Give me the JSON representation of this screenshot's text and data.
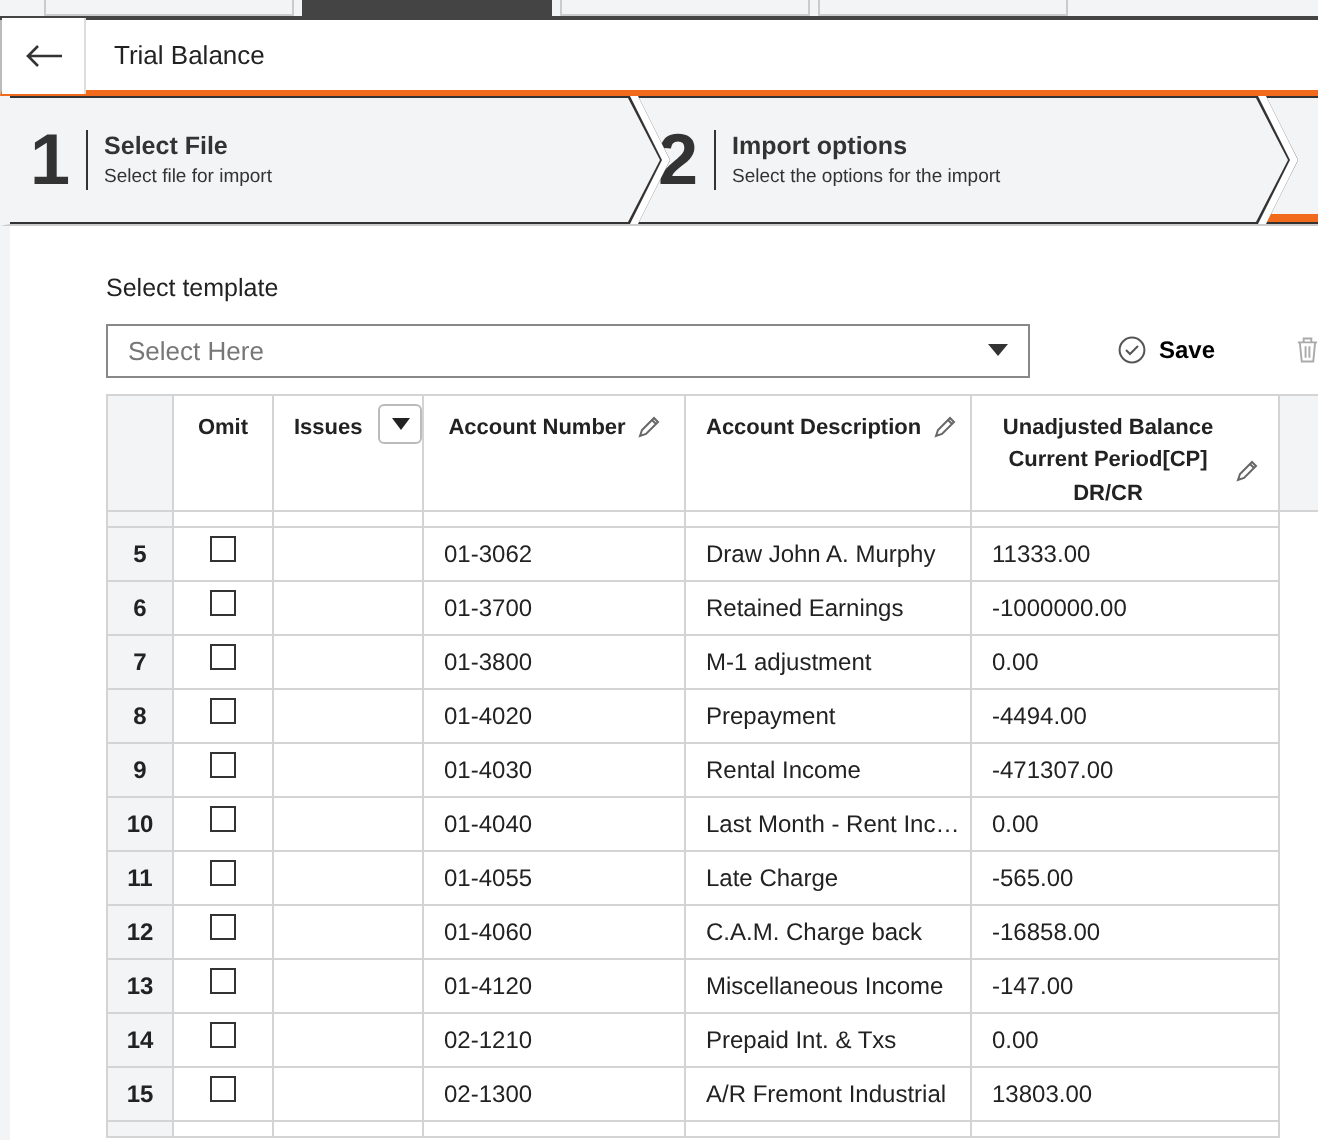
{
  "app_tabs": [
    {
      "selected": false
    },
    {
      "selected": true
    },
    {
      "selected": false
    },
    {
      "selected": false
    }
  ],
  "header": {
    "title": "Trial Balance"
  },
  "steps": [
    {
      "number": "1",
      "title": "Select File",
      "subtitle": "Select file for import",
      "selected": false
    },
    {
      "number": "2",
      "title": "Import options",
      "subtitle": "Select the options for the import",
      "selected": false
    },
    {
      "selected": true
    }
  ],
  "template": {
    "label": "Select template",
    "placeholder": "Select Here",
    "save": "Save"
  },
  "table": {
    "columns": [
      {
        "label": "Omit",
        "editable": false,
        "filter": false
      },
      {
        "label": "Issues",
        "editable": false,
        "filter": true
      },
      {
        "label": "Account Number",
        "editable": true,
        "filter": false
      },
      {
        "label": "Account Description",
        "editable": true,
        "filter": false
      },
      {
        "label": "Unadjusted Balance Current Period[CP] DR/CR",
        "editable": true,
        "filter": false
      }
    ],
    "rows": [
      {
        "index": "5",
        "checked": false,
        "account_number": "01-3062",
        "account_description": "Draw John A. Murphy",
        "balance": "11333.00"
      },
      {
        "index": "6",
        "checked": false,
        "account_number": "01-3700",
        "account_description": "Retained Earnings",
        "balance": "-1000000.00"
      },
      {
        "index": "7",
        "checked": false,
        "account_number": "01-3800",
        "account_description": "M-1 adjustment",
        "balance": "0.00"
      },
      {
        "index": "8",
        "checked": false,
        "account_number": "01-4020",
        "account_description": "Prepayment",
        "balance": "-4494.00"
      },
      {
        "index": "9",
        "checked": false,
        "account_number": "01-4030",
        "account_description": "Rental Income",
        "balance": "-471307.00"
      },
      {
        "index": "10",
        "checked": false,
        "account_number": "01-4040",
        "account_description": "Last Month - Rent Inc…",
        "balance": "0.00"
      },
      {
        "index": "11",
        "checked": false,
        "account_number": "01-4055",
        "account_description": "Late Charge",
        "balance": "-565.00"
      },
      {
        "index": "12",
        "checked": false,
        "account_number": "01-4060",
        "account_description": "C.A.M. Charge back",
        "balance": "-16858.00"
      },
      {
        "index": "13",
        "checked": false,
        "account_number": "01-4120",
        "account_description": "Miscellaneous Income",
        "balance": "-147.00"
      },
      {
        "index": "14",
        "checked": false,
        "account_number": "02-1210",
        "account_description": "Prepaid Int. & Txs",
        "balance": "0.00"
      },
      {
        "index": "15",
        "checked": false,
        "account_number": "02-1300",
        "account_description": "A/R Fremont Industrial",
        "balance": "13803.00"
      }
    ]
  }
}
